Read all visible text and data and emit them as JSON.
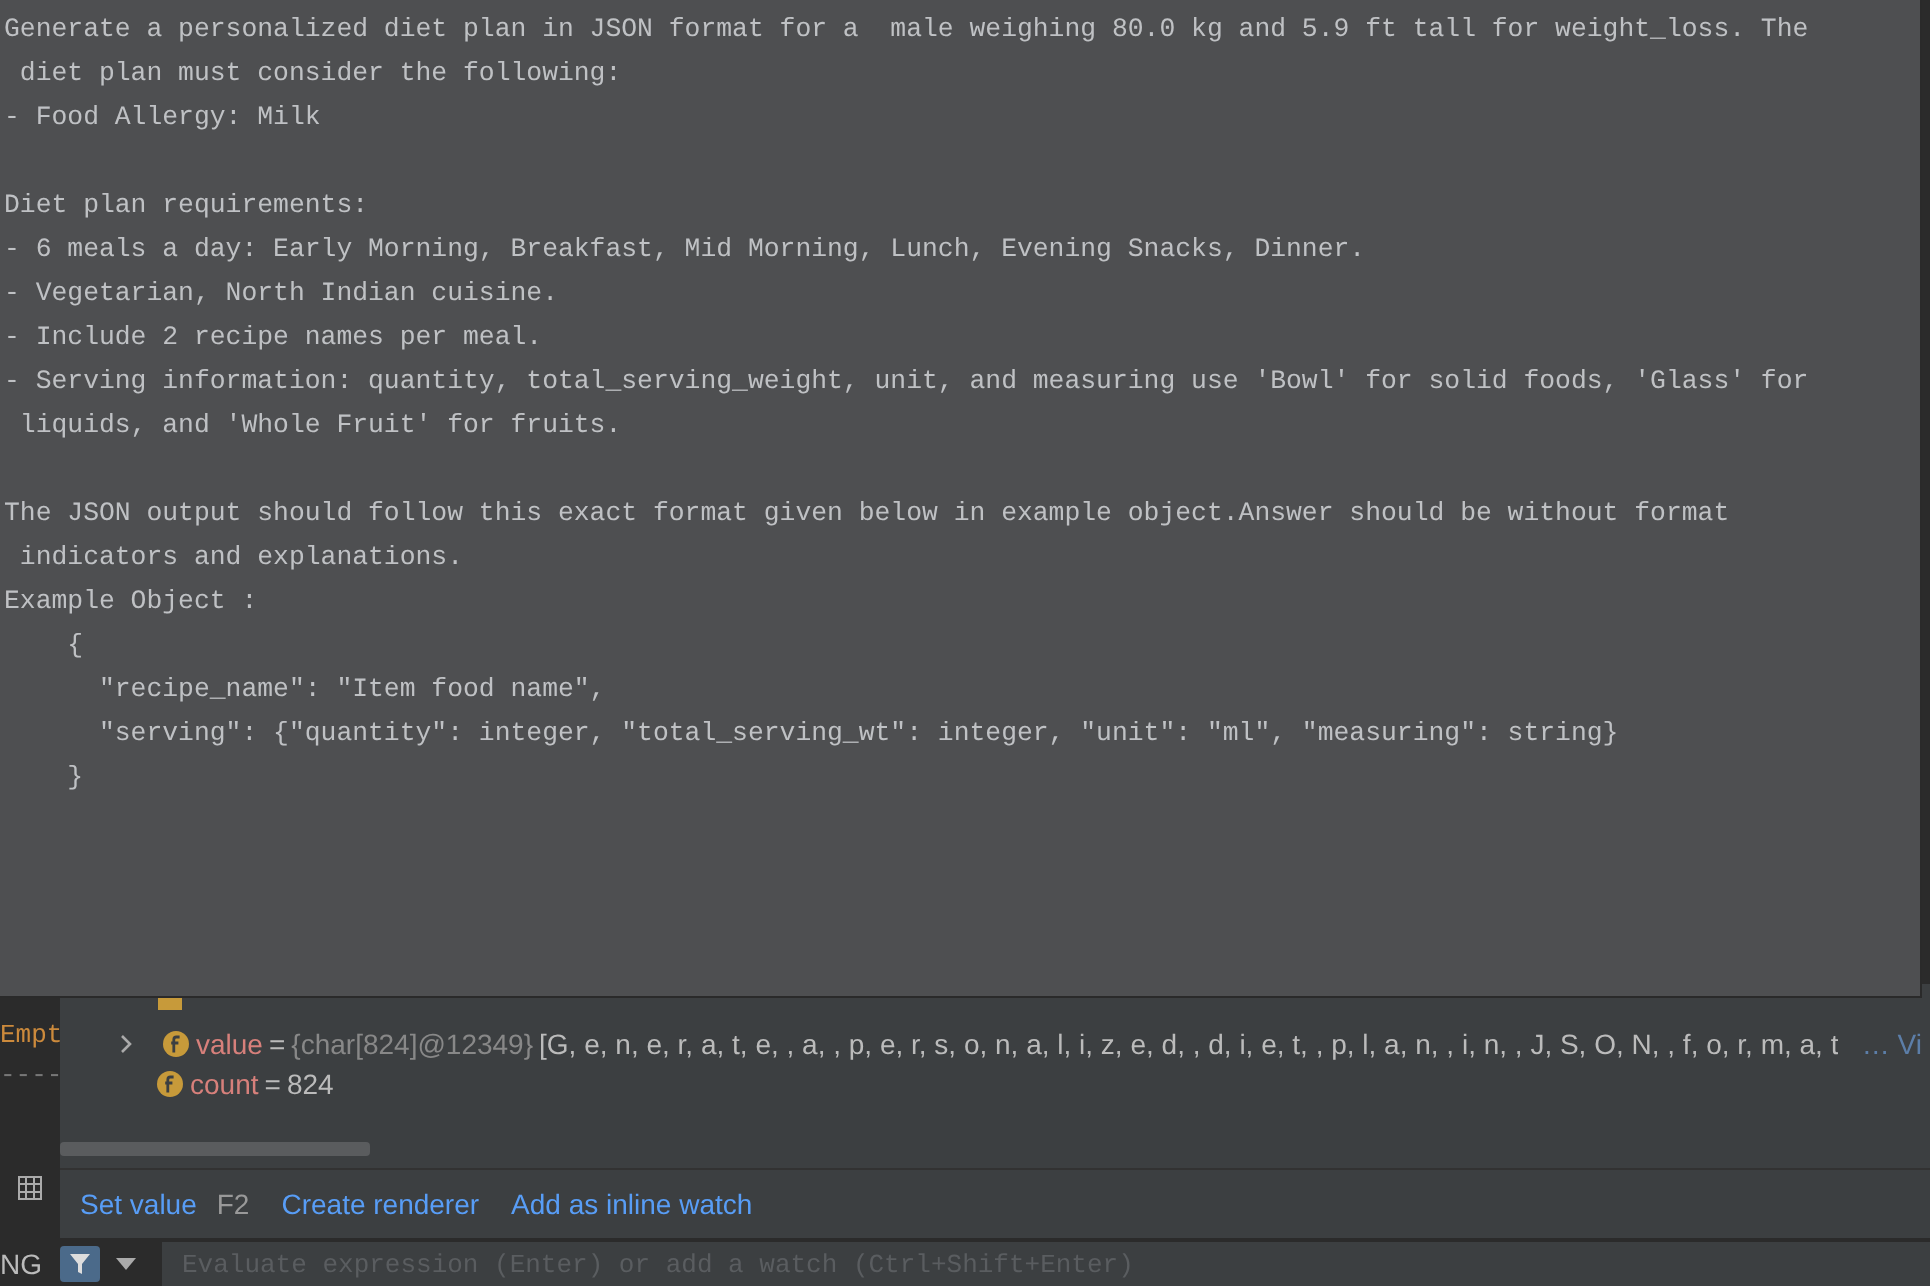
{
  "popup": {
    "paragraphs": [
      {
        "lines": [
          "Generate a personalized diet plan in JSON format for a  male weighing 80.0 kg and 5.9 ft tall for weight_loss. The",
          " diet plan must consider the following:",
          "- Food Allergy: Milk"
        ]
      },
      {
        "lines": [
          "Diet plan requirements:",
          "- 6 meals a day: Early Morning, Breakfast, Mid Morning, Lunch, Evening Snacks, Dinner.",
          "- Vegetarian, North Indian cuisine.",
          "- Include 2 recipe names per meal.",
          "- Serving information: quantity, total_serving_weight, unit, and measuring use 'Bowl' for solid foods, 'Glass' for",
          " liquids, and 'Whole Fruit' for fruits."
        ]
      },
      {
        "lines": [
          "The JSON output should follow this exact format given below in example object.Answer should be without format",
          " indicators and explanations.",
          "Example Object :",
          "    {",
          "      \"recipe_name\": \"Item food name\",",
          "      \"serving\": {\"quantity\": integer, \"total_serving_wt\": integer, \"unit\": \"ml\", \"measuring\": string}",
          "    }"
        ]
      }
    ]
  },
  "gutter": {
    "lines": [
      "Empt",
      "----"
    ]
  },
  "variables": [
    {
      "kind": "object"
    },
    {
      "kind": "field",
      "expanded": false,
      "name": "value",
      "separator": "=",
      "type": "{char[824]@12349}",
      "value": "[G, e, n, e, r, a, t, e,  , a,  , p, e, r, s, o, n, a, l, i, z, e, d,  , d, i, e, t,  , p, l, a, n,  , i, n,  , J, S, O, N,  , f, o, r, m, a, t",
      "more": "… Vi"
    },
    {
      "kind": "field",
      "name": "count",
      "separator": "=",
      "value": "824"
    }
  ],
  "actions": [
    {
      "label": "Set value",
      "shortcut": "F2"
    },
    {
      "label": "Create renderer"
    },
    {
      "label": "Add as inline watch"
    }
  ],
  "bottom": {
    "tab_label": "NG",
    "watch_input": {
      "placeholder": "Evaluate expression (Enter) or add a watch (Ctrl+Shift+Enter)"
    }
  }
}
